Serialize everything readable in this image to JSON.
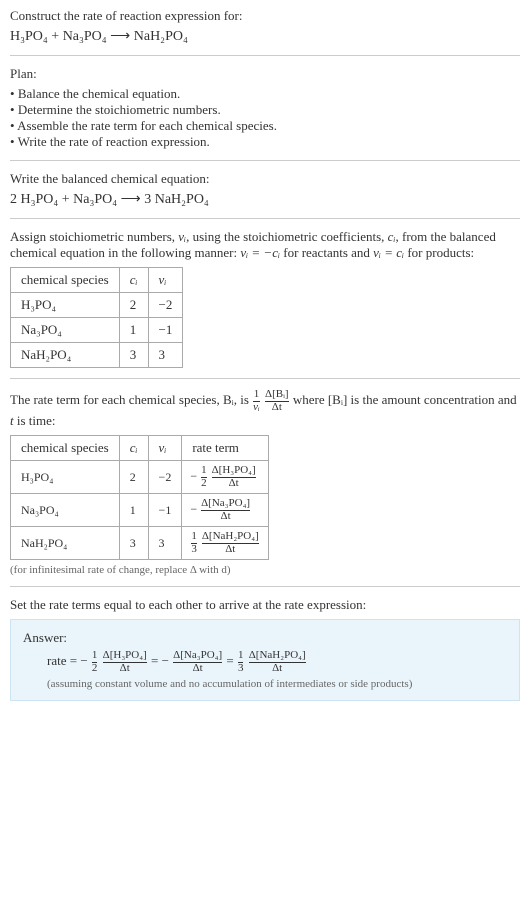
{
  "prompt": {
    "title": "Construct the rate of reaction expression for:",
    "equation_lhs1": "H₃PO₄",
    "equation_plus1": " + ",
    "equation_lhs2": "Na₃PO₄",
    "arrow": " ⟶ ",
    "equation_rhs1": "NaH₂PO₄"
  },
  "plan": {
    "heading": "Plan:",
    "items": [
      "Balance the chemical equation.",
      "Determine the stoichiometric numbers.",
      "Assemble the rate term for each chemical species.",
      "Write the rate of reaction expression."
    ]
  },
  "balanced": {
    "heading": "Write the balanced chemical equation:",
    "equation": "2 H₃PO₄ + Na₃PO₄ ⟶ 3 NaH₂PO₄"
  },
  "stoich": {
    "intro_a": "Assign stoichiometric numbers, ",
    "nu_i": "νᵢ",
    "intro_b": ", using the stoichiometric coefficients, ",
    "c_i": "cᵢ",
    "intro_c": ", from the balanced chemical equation in the following manner: ",
    "rel1": "νᵢ = −cᵢ",
    "intro_d": " for reactants and ",
    "rel2": "νᵢ = cᵢ",
    "intro_e": " for products:",
    "headers": [
      "chemical species",
      "cᵢ",
      "νᵢ"
    ],
    "rows": [
      {
        "species": "H₃PO₄",
        "c": "2",
        "nu": "−2"
      },
      {
        "species": "Na₃PO₄",
        "c": "1",
        "nu": "−1"
      },
      {
        "species": "NaH₂PO₄",
        "c": "3",
        "nu": "3"
      }
    ]
  },
  "rateterm": {
    "intro_a": "The rate term for each chemical species, Bᵢ, is ",
    "frac_coef_top": "1",
    "frac_coef_bot": "νᵢ",
    "frac_main_top": "Δ[Bᵢ]",
    "frac_main_bot": "Δt",
    "intro_b": " where [Bᵢ] is the amount concentration and ",
    "t_it": "t",
    "intro_c": " is time:",
    "headers": [
      "chemical species",
      "cᵢ",
      "νᵢ",
      "rate term"
    ],
    "rows": [
      {
        "species": "H₃PO₄",
        "c": "2",
        "nu": "−2",
        "coef_top": "1",
        "coef_bot": "2",
        "lead": "−",
        "num": "Δ[H₃PO₄]",
        "den": "Δt"
      },
      {
        "species": "Na₃PO₄",
        "c": "1",
        "nu": "−1",
        "coef_top": "",
        "coef_bot": "",
        "lead": "−",
        "num": "Δ[Na₃PO₄]",
        "den": "Δt"
      },
      {
        "species": "NaH₂PO₄",
        "c": "3",
        "nu": "3",
        "coef_top": "1",
        "coef_bot": "3",
        "lead": "",
        "num": "Δ[NaH₂PO₄]",
        "den": "Δt"
      }
    ],
    "caption": "(for infinitesimal rate of change, replace Δ with d)"
  },
  "final": {
    "heading": "Set the rate terms equal to each other to arrive at the rate expression:",
    "answer_label": "Answer:",
    "rate_word": "rate = ",
    "minus": "−",
    "half_top": "1",
    "half_bot": "2",
    "t1_top": "Δ[H₃PO₄]",
    "t1_bot": "Δt",
    "eq1": " = ",
    "t2_top": "Δ[Na₃PO₄]",
    "t2_bot": "Δt",
    "eq2": " = ",
    "third_top": "1",
    "third_bot": "3",
    "t3_top": "Δ[NaH₂PO₄]",
    "t3_bot": "Δt",
    "assume": "(assuming constant volume and no accumulation of intermediates or side products)"
  }
}
